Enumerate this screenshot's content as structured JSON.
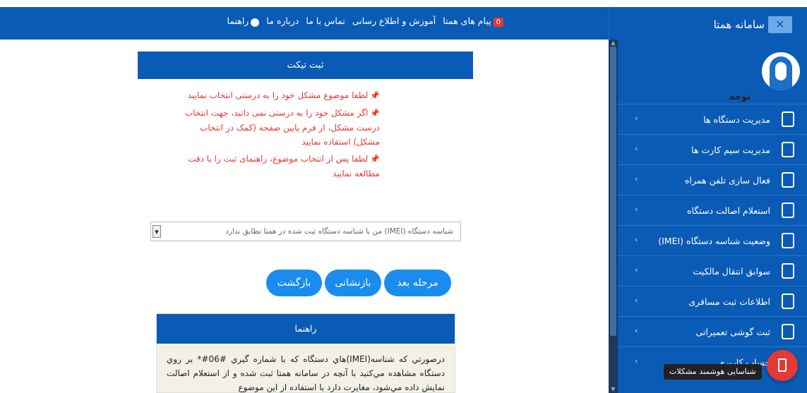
{
  "header": {
    "brand_title": "سامانه همتا",
    "close_icon": "close-icon",
    "nav": {
      "help": "راهنما",
      "about": "درباره ما",
      "contact": "تماس با ما",
      "training": "آموزش و اطلاع رسانی",
      "messages": "پیام های همتا",
      "messages_count": "0"
    }
  },
  "sidebar": {
    "items": [
      {
        "label": "مدیریت دستگاه ها",
        "icon": "device-icon"
      },
      {
        "label": "مدیریت سیم کارت ها",
        "icon": "simcard-icon"
      },
      {
        "label": "فعال سازی تلفن همراه",
        "icon": "activate-phone-icon"
      },
      {
        "label": "استعلام اصالت دستگاه",
        "icon": "inquiry-icon"
      },
      {
        "label": "وضعیت شناسه دستگاه (IMEI)",
        "icon": "imei-status-icon"
      },
      {
        "label": "سوابق انتقال مالکیت",
        "icon": "transfer-icon"
      },
      {
        "label": "اطلاعات ثبت مسافری",
        "icon": "traveler-icon"
      },
      {
        "label": "ثبت گوشی تعمیراتی",
        "icon": "repair-icon"
      },
      {
        "label": "حساب کاربری",
        "icon": "account-icon"
      }
    ]
  },
  "ticket": {
    "title": "ثبت تیکت",
    "note_label": "توجه",
    "notes": [
      "لطفا موضوع مشکل خود را به درستی انتخاب نمایید",
      "اگر مشکل خود را به درستی نمی دانید، جهت انتخاب درست مشکل، از فرم پایین صفحه (کمک در انتخاب مشکل) استفاده نمایید",
      "لطفا پس از انتخاب موضوع، راهنمای ثبت را با دقت مطالعه نمایید"
    ],
    "select_value": "شناسه دستگاه (IMEI) من با شناسه دستگاه ثبت شده در همتا تطابق ندارد",
    "buttons": {
      "next": "مرحله بعد",
      "reset": "بازنشانی",
      "back": "بازگشت"
    }
  },
  "guide": {
    "title": "راهنما",
    "body": "درصورتي که شناسه(IMEI)هاي دستگاه که با شماره گيري #06#* بر روي دستگاه مشاهده مي‌کنيد با آنچه در سامانه همتا ثبت شده و از استعلام اصالت نمايش داده مي‌شود، مغايرت دارد با استفاده از اين موضوع"
  },
  "floating": {
    "tooltip": "شناسایی هوشمند مشکلات",
    "accent": "#e53935"
  },
  "colors": {
    "primary": "#0a5bb5",
    "button": "#1a8cf0",
    "warning_text": "#e53935"
  }
}
